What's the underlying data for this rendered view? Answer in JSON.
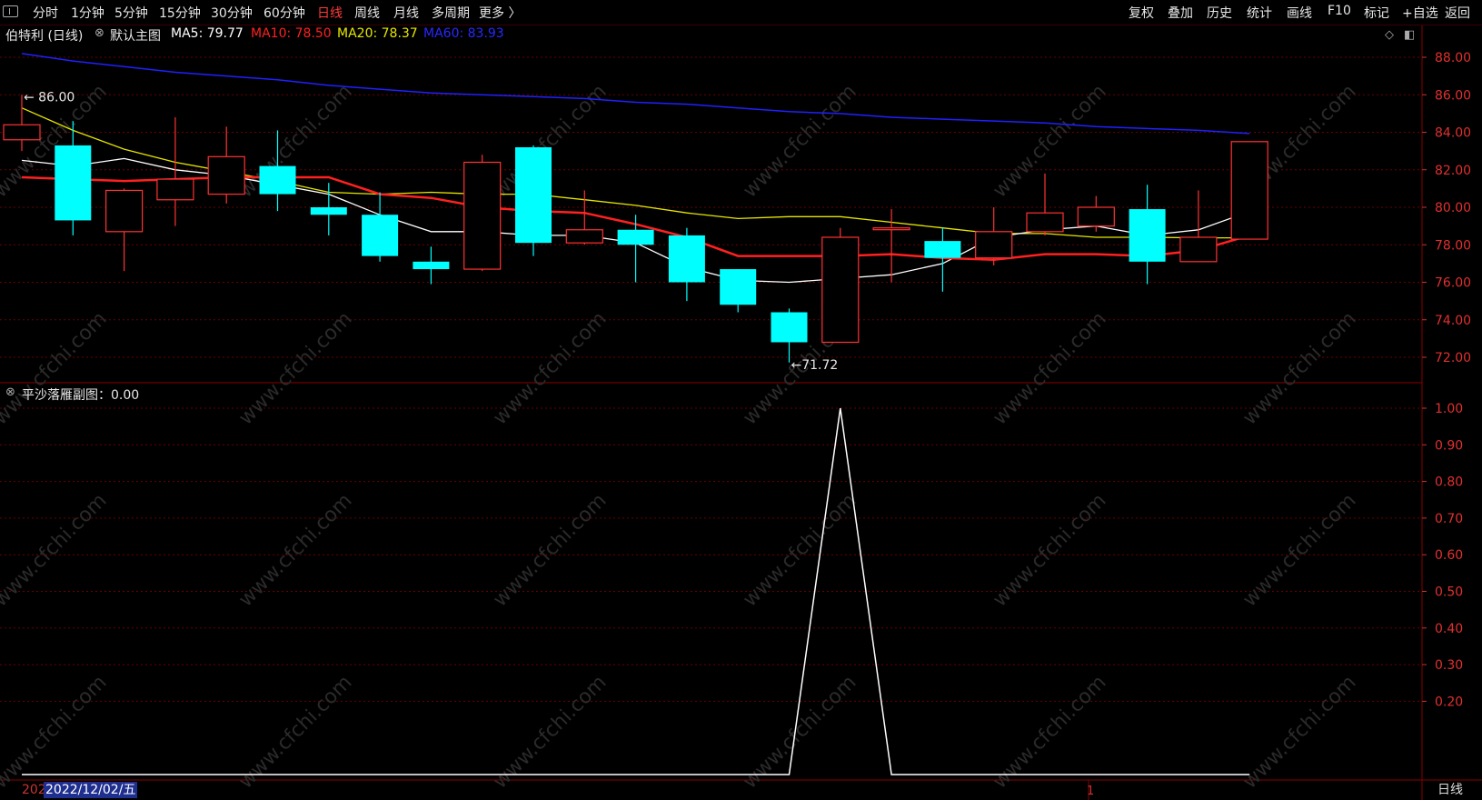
{
  "toolbar": {
    "left": [
      "分时",
      "1分钟",
      "5分钟",
      "15分钟",
      "30分钟",
      "60分钟",
      "日线",
      "周线",
      "月线",
      "多周期",
      "更多 〉"
    ],
    "active": "日线",
    "right": [
      "复权",
      "叠加",
      "历史",
      "统计",
      "画线",
      "F10",
      "标记",
      "+自选",
      "返回"
    ]
  },
  "main_legend": {
    "stock": "伯特利 (日线)",
    "chart_name": "默认主图",
    "ma5": "MA5: 79.77",
    "ma10": "MA10: 78.50",
    "ma20": "MA20: 78.37",
    "ma60": "MA60: 83.93",
    "colors": {
      "ma5": "#ffffff",
      "ma10": "#ff2020",
      "ma20": "#e6e600",
      "ma60": "#2020ff",
      "up": "#ff3232",
      "down": "#00ffff"
    }
  },
  "sub_legend": {
    "title": "平沙落雁副图：0.00"
  },
  "annotations": {
    "high": "86.00",
    "low": "71.72"
  },
  "footer": {
    "date_prefix": "202",
    "date": "2022/12/02/五",
    "period": "日线",
    "marker": "1"
  },
  "watermark": "www.cfchi.com",
  "chart_data": [
    {
      "type": "candlestick",
      "y_ticks": [
        "88.00",
        "86.00",
        "84.00",
        "82.00",
        "80.00",
        "78.00",
        "76.00",
        "74.00",
        "72.00"
      ],
      "ylim": [
        71.72,
        88.0
      ],
      "candles": [
        {
          "o": 83.6,
          "c": 84.4,
          "h": 86.0,
          "l": 83.0
        },
        {
          "o": 83.3,
          "c": 79.3,
          "h": 84.6,
          "l": 78.5
        },
        {
          "o": 78.7,
          "c": 80.9,
          "h": 81.0,
          "l": 76.6
        },
        {
          "o": 80.4,
          "c": 81.5,
          "h": 84.8,
          "l": 79.0
        },
        {
          "o": 80.7,
          "c": 82.7,
          "h": 84.3,
          "l": 80.2
        },
        {
          "o": 82.2,
          "c": 80.7,
          "h": 84.1,
          "l": 79.8
        },
        {
          "o": 80.0,
          "c": 79.6,
          "h": 81.3,
          "l": 78.5
        },
        {
          "o": 79.6,
          "c": 77.4,
          "h": 80.8,
          "l": 77.1
        },
        {
          "o": 77.1,
          "c": 76.7,
          "h": 77.9,
          "l": 75.9
        },
        {
          "o": 76.7,
          "c": 82.4,
          "h": 82.8,
          "l": 76.6
        },
        {
          "o": 83.2,
          "c": 78.1,
          "h": 83.3,
          "l": 77.4
        },
        {
          "o": 78.1,
          "c": 78.8,
          "h": 80.9,
          "l": 78.0
        },
        {
          "o": 78.8,
          "c": 78.0,
          "h": 79.6,
          "l": 76.0
        },
        {
          "o": 78.5,
          "c": 76.0,
          "h": 78.9,
          "l": 75.0
        },
        {
          "o": 76.7,
          "c": 74.8,
          "h": 76.7,
          "l": 74.4
        },
        {
          "o": 74.4,
          "c": 72.8,
          "h": 74.6,
          "l": 71.72
        },
        {
          "o": 72.8,
          "c": 78.4,
          "h": 78.9,
          "l": 72.8
        },
        {
          "o": 78.9,
          "c": 78.9,
          "h": 79.9,
          "l": 76.0
        },
        {
          "o": 78.2,
          "c": 77.3,
          "h": 78.9,
          "l": 75.5
        },
        {
          "o": 77.3,
          "c": 78.7,
          "h": 80.0,
          "l": 76.9
        },
        {
          "o": 78.7,
          "c": 79.7,
          "h": 81.8,
          "l": 78.5
        },
        {
          "o": 79.0,
          "c": 80.0,
          "h": 80.6,
          "l": 78.7
        },
        {
          "o": 79.9,
          "c": 77.1,
          "h": 81.2,
          "l": 75.9
        },
        {
          "o": 77.1,
          "c": 78.4,
          "h": 80.9,
          "l": 77.1
        },
        {
          "o": 78.3,
          "c": 83.5,
          "h": 83.5,
          "l": 78.3
        }
      ],
      "ma5": [
        82.5,
        82.2,
        82.6,
        82.0,
        81.7,
        81.2,
        80.7,
        79.6,
        78.7,
        78.7,
        78.5,
        78.5,
        78.1,
        76.8,
        76.1,
        76.0,
        76.2,
        76.4,
        77.0,
        78.4,
        78.8,
        79.0,
        78.5,
        78.8,
        79.77
      ],
      "ma10": [
        81.6,
        81.5,
        81.4,
        81.5,
        81.6,
        81.6,
        81.6,
        80.7,
        80.5,
        80.0,
        79.8,
        79.7,
        79.1,
        78.4,
        77.4,
        77.4,
        77.4,
        77.5,
        77.3,
        77.2,
        77.5,
        77.5,
        77.4,
        77.7,
        78.5
      ],
      "ma20": [
        85.3,
        84.1,
        83.1,
        82.4,
        81.9,
        81.4,
        80.8,
        80.7,
        80.8,
        80.7,
        80.7,
        80.4,
        80.1,
        79.7,
        79.4,
        79.5,
        79.5,
        79.2,
        78.9,
        78.6,
        78.6,
        78.4,
        78.4,
        78.37,
        78.37
      ],
      "ma60": [
        88.2,
        87.8,
        87.5,
        87.2,
        87.0,
        86.8,
        86.5,
        86.3,
        86.1,
        86.0,
        85.9,
        85.8,
        85.6,
        85.5,
        85.3,
        85.1,
        85.0,
        84.8,
        84.7,
        84.6,
        84.5,
        84.3,
        84.2,
        84.1,
        83.93
      ]
    },
    {
      "type": "line",
      "y_ticks": [
        "1.00",
        "0.90",
        "0.80",
        "0.70",
        "0.60",
        "0.50",
        "0.40",
        "0.30",
        "0.20"
      ],
      "ylim": [
        0,
        1.0
      ],
      "values": [
        0,
        0,
        0,
        0,
        0,
        0,
        0,
        0,
        0,
        0,
        0,
        0,
        0,
        0,
        0,
        0,
        1,
        0,
        0,
        0,
        0,
        0,
        0,
        0,
        0
      ]
    }
  ]
}
